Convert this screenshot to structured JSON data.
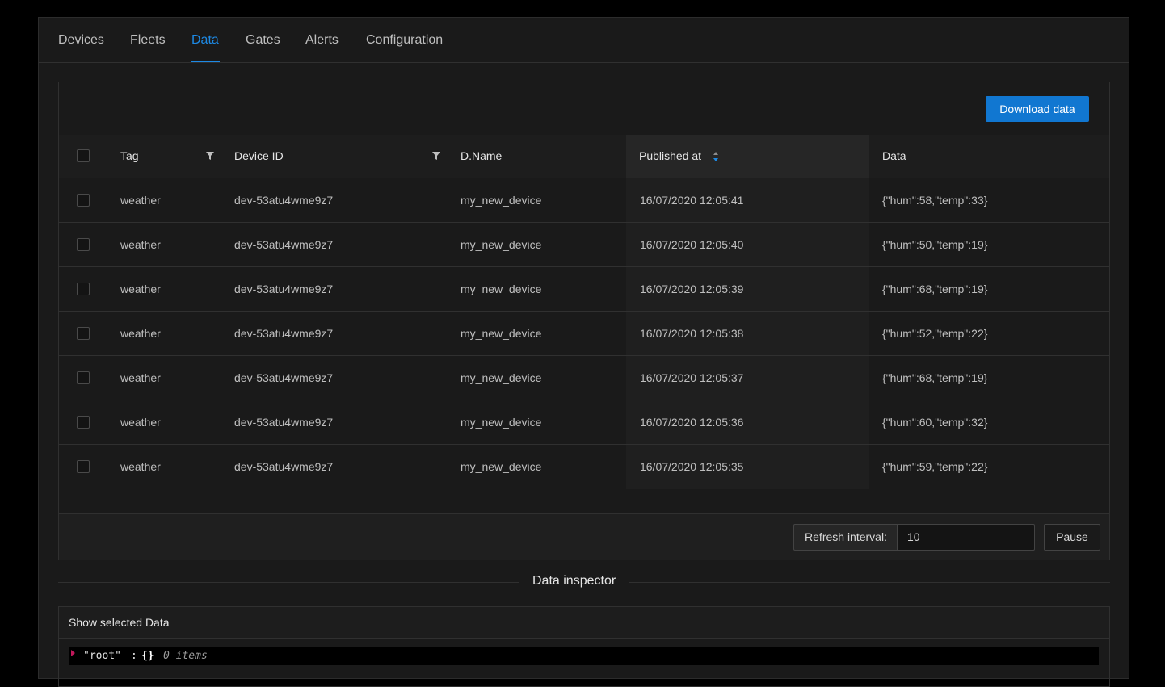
{
  "tabs": [
    {
      "label": "Devices"
    },
    {
      "label": "Fleets"
    },
    {
      "label": "Data",
      "active": true
    },
    {
      "label": "Gates"
    },
    {
      "label": "Alerts"
    },
    {
      "label": "Configuration"
    }
  ],
  "toolbar": {
    "download_label": "Download data"
  },
  "table": {
    "columns": [
      "Tag",
      "Device ID",
      "D.Name",
      "Published at",
      "Data"
    ],
    "sorted_column": "Published at",
    "rows": [
      {
        "tag": "weather",
        "device_id": "dev-53atu4wme9z7",
        "name": "my_new_device",
        "published_at": "16/07/2020 12:05:41",
        "data": "{\"hum\":58,\"temp\":33}"
      },
      {
        "tag": "weather",
        "device_id": "dev-53atu4wme9z7",
        "name": "my_new_device",
        "published_at": "16/07/2020 12:05:40",
        "data": "{\"hum\":50,\"temp\":19}"
      },
      {
        "tag": "weather",
        "device_id": "dev-53atu4wme9z7",
        "name": "my_new_device",
        "published_at": "16/07/2020 12:05:39",
        "data": "{\"hum\":68,\"temp\":19}"
      },
      {
        "tag": "weather",
        "device_id": "dev-53atu4wme9z7",
        "name": "my_new_device",
        "published_at": "16/07/2020 12:05:38",
        "data": "{\"hum\":52,\"temp\":22}"
      },
      {
        "tag": "weather",
        "device_id": "dev-53atu4wme9z7",
        "name": "my_new_device",
        "published_at": "16/07/2020 12:05:37",
        "data": "{\"hum\":68,\"temp\":19}"
      },
      {
        "tag": "weather",
        "device_id": "dev-53atu4wme9z7",
        "name": "my_new_device",
        "published_at": "16/07/2020 12:05:36",
        "data": "{\"hum\":60,\"temp\":32}"
      },
      {
        "tag": "weather",
        "device_id": "dev-53atu4wme9z7",
        "name": "my_new_device",
        "published_at": "16/07/2020 12:05:35",
        "data": "{\"hum\":59,\"temp\":22}"
      }
    ]
  },
  "footer": {
    "refresh_label": "Refresh interval:",
    "refresh_value": "10",
    "pause_label": "Pause"
  },
  "inspector": {
    "divider_title": "Data inspector",
    "card_title": "Show selected Data",
    "json_key": "\"root\"",
    "json_colon": ":",
    "json_brace": "{}",
    "json_count": "0 items"
  },
  "colors": {
    "accent": "#1d89e4",
    "primary_button": "#1177d1",
    "background": "#1a1a1a",
    "json_caret": "#c2185b"
  }
}
